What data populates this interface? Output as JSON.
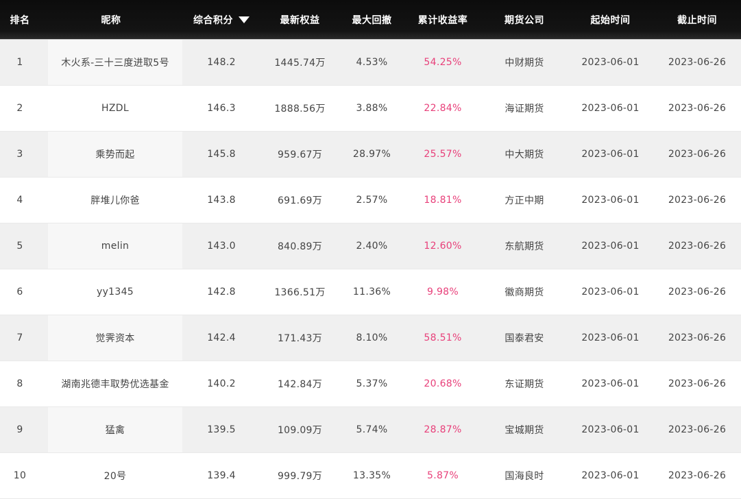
{
  "headers": {
    "rank": "排名",
    "name": "昵称",
    "score": "综合积分",
    "equity": "最新权益",
    "drawdown": "最大回撤",
    "return_rate": "累计收益率",
    "company": "期货公司",
    "start": "起始时间",
    "end": "截止时间"
  },
  "colors": {
    "header_bg": "#111111",
    "rate": "#e8407a",
    "row_alt": "#f0f0f0"
  },
  "rows": [
    {
      "rank": "1",
      "name": "木火系-三十三度进取5号",
      "score": "148.2",
      "equity": "1445.74万",
      "drawdown": "4.53%",
      "rate": "54.25%",
      "company": "中财期货",
      "start": "2023-06-01",
      "end": "2023-06-26"
    },
    {
      "rank": "2",
      "name": "HZDL",
      "score": "146.3",
      "equity": "1888.56万",
      "drawdown": "3.88%",
      "rate": "22.84%",
      "company": "海证期货",
      "start": "2023-06-01",
      "end": "2023-06-26"
    },
    {
      "rank": "3",
      "name": "乘势而起",
      "score": "145.8",
      "equity": "959.67万",
      "drawdown": "28.97%",
      "rate": "25.57%",
      "company": "中大期货",
      "start": "2023-06-01",
      "end": "2023-06-26"
    },
    {
      "rank": "4",
      "name": "胖堆儿你爸",
      "score": "143.8",
      "equity": "691.69万",
      "drawdown": "2.57%",
      "rate": "18.81%",
      "company": "方正中期",
      "start": "2023-06-01",
      "end": "2023-06-26"
    },
    {
      "rank": "5",
      "name": "melin",
      "score": "143.0",
      "equity": "840.89万",
      "drawdown": "2.40%",
      "rate": "12.60%",
      "company": "东航期货",
      "start": "2023-06-01",
      "end": "2023-06-26"
    },
    {
      "rank": "6",
      "name": "yy1345",
      "score": "142.8",
      "equity": "1366.51万",
      "drawdown": "11.36%",
      "rate": "9.98%",
      "company": "徽商期货",
      "start": "2023-06-01",
      "end": "2023-06-26"
    },
    {
      "rank": "7",
      "name": "觉霁资本",
      "score": "142.4",
      "equity": "171.43万",
      "drawdown": "8.10%",
      "rate": "58.51%",
      "company": "国泰君安",
      "start": "2023-06-01",
      "end": "2023-06-26"
    },
    {
      "rank": "8",
      "name": "湖南兆德丰取势优选基金",
      "score": "140.2",
      "equity": "142.84万",
      "drawdown": "5.37%",
      "rate": "20.68%",
      "company": "东证期货",
      "start": "2023-06-01",
      "end": "2023-06-26"
    },
    {
      "rank": "9",
      "name": "猛禽",
      "score": "139.5",
      "equity": "109.09万",
      "drawdown": "5.74%",
      "rate": "28.87%",
      "company": "宝城期货",
      "start": "2023-06-01",
      "end": "2023-06-26"
    },
    {
      "rank": "10",
      "name": "20号",
      "score": "139.4",
      "equity": "999.79万",
      "drawdown": "13.35%",
      "rate": "5.87%",
      "company": "国海良时",
      "start": "2023-06-01",
      "end": "2023-06-26"
    }
  ]
}
